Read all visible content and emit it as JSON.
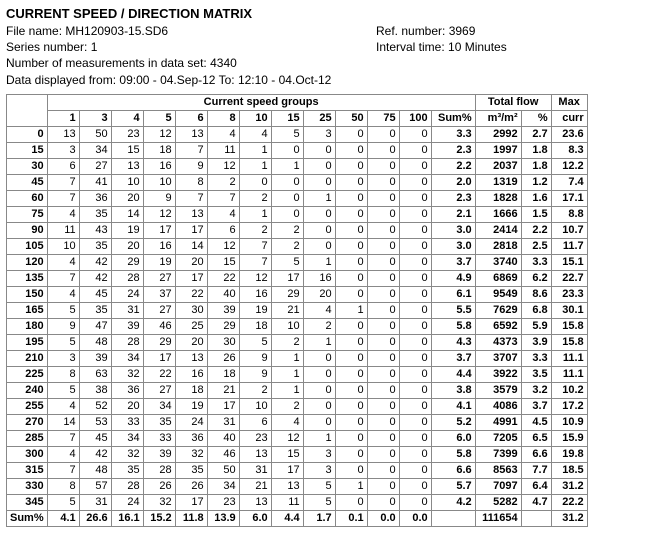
{
  "header": {
    "title": "CURRENT SPEED / DIRECTION MATRIX",
    "file_label": "File name: ",
    "file_value": "MH120903-15.SD6",
    "ref_label": "Ref. number: ",
    "ref_value": "3969",
    "series_label": "Series number: ",
    "series_value": "1",
    "interval_label": "Interval time: ",
    "interval_value": "10 Minutes",
    "count_label": "Number of measurements in data set: ",
    "count_value": "4340",
    "range_label": "Data displayed from: ",
    "range_from": "09:00 - 04.Sep-12",
    "range_to_label": "  To: ",
    "range_to": "12:10 - 04.Oct-12"
  },
  "columns": {
    "group_title": "Current speed groups",
    "total_flow_title": "Total flow",
    "max_title": "Max",
    "speed_headers": [
      "1",
      "3",
      "4",
      "5",
      "6",
      "8",
      "10",
      "15",
      "25",
      "50",
      "75",
      "100"
    ],
    "sum_pct": "Sum%",
    "flow_unit": "m³/m²",
    "pct": "%",
    "curr": "curr"
  },
  "rows": [
    {
      "dir": "0",
      "v": [
        "13",
        "50",
        "23",
        "12",
        "13",
        "4",
        "4",
        "5",
        "3",
        "0",
        "0",
        "0"
      ],
      "sum": "3.3",
      "flow": "2992",
      "pct": "2.7",
      "curr": "23.6"
    },
    {
      "dir": "15",
      "v": [
        "3",
        "34",
        "15",
        "18",
        "7",
        "11",
        "1",
        "0",
        "0",
        "0",
        "0",
        "0"
      ],
      "sum": "2.3",
      "flow": "1997",
      "pct": "1.8",
      "curr": "8.3"
    },
    {
      "dir": "30",
      "v": [
        "6",
        "27",
        "13",
        "16",
        "9",
        "12",
        "1",
        "1",
        "0",
        "0",
        "0",
        "0"
      ],
      "sum": "2.2",
      "flow": "2037",
      "pct": "1.8",
      "curr": "12.2"
    },
    {
      "dir": "45",
      "v": [
        "7",
        "41",
        "10",
        "10",
        "8",
        "2",
        "0",
        "0",
        "0",
        "0",
        "0",
        "0"
      ],
      "sum": "2.0",
      "flow": "1319",
      "pct": "1.2",
      "curr": "7.4"
    },
    {
      "dir": "60",
      "v": [
        "7",
        "36",
        "20",
        "9",
        "7",
        "7",
        "2",
        "0",
        "1",
        "0",
        "0",
        "0"
      ],
      "sum": "2.3",
      "flow": "1828",
      "pct": "1.6",
      "curr": "17.1"
    },
    {
      "dir": "75",
      "v": [
        "4",
        "35",
        "14",
        "12",
        "13",
        "4",
        "1",
        "0",
        "0",
        "0",
        "0",
        "0"
      ],
      "sum": "2.1",
      "flow": "1666",
      "pct": "1.5",
      "curr": "8.8"
    },
    {
      "dir": "90",
      "v": [
        "11",
        "43",
        "19",
        "17",
        "17",
        "6",
        "2",
        "2",
        "0",
        "0",
        "0",
        "0"
      ],
      "sum": "3.0",
      "flow": "2414",
      "pct": "2.2",
      "curr": "10.7"
    },
    {
      "dir": "105",
      "v": [
        "10",
        "35",
        "20",
        "16",
        "14",
        "12",
        "7",
        "2",
        "0",
        "0",
        "0",
        "0"
      ],
      "sum": "3.0",
      "flow": "2818",
      "pct": "2.5",
      "curr": "11.7"
    },
    {
      "dir": "120",
      "v": [
        "4",
        "42",
        "29",
        "19",
        "20",
        "15",
        "7",
        "5",
        "1",
        "0",
        "0",
        "0"
      ],
      "sum": "3.7",
      "flow": "3740",
      "pct": "3.3",
      "curr": "15.1"
    },
    {
      "dir": "135",
      "v": [
        "7",
        "42",
        "28",
        "27",
        "17",
        "22",
        "12",
        "17",
        "16",
        "0",
        "0",
        "0"
      ],
      "sum": "4.9",
      "flow": "6869",
      "pct": "6.2",
      "curr": "22.7"
    },
    {
      "dir": "150",
      "v": [
        "4",
        "45",
        "24",
        "37",
        "22",
        "40",
        "16",
        "29",
        "20",
        "0",
        "0",
        "0"
      ],
      "sum": "6.1",
      "flow": "9549",
      "pct": "8.6",
      "curr": "23.3"
    },
    {
      "dir": "165",
      "v": [
        "5",
        "35",
        "31",
        "27",
        "30",
        "39",
        "19",
        "21",
        "4",
        "1",
        "0",
        "0"
      ],
      "sum": "5.5",
      "flow": "7629",
      "pct": "6.8",
      "curr": "30.1"
    },
    {
      "dir": "180",
      "v": [
        "9",
        "47",
        "39",
        "46",
        "25",
        "29",
        "18",
        "10",
        "2",
        "0",
        "0",
        "0"
      ],
      "sum": "5.8",
      "flow": "6592",
      "pct": "5.9",
      "curr": "15.8"
    },
    {
      "dir": "195",
      "v": [
        "5",
        "48",
        "28",
        "29",
        "20",
        "30",
        "5",
        "2",
        "1",
        "0",
        "0",
        "0"
      ],
      "sum": "4.3",
      "flow": "4373",
      "pct": "3.9",
      "curr": "15.8"
    },
    {
      "dir": "210",
      "v": [
        "3",
        "39",
        "34",
        "17",
        "13",
        "26",
        "9",
        "1",
        "0",
        "0",
        "0",
        "0"
      ],
      "sum": "3.7",
      "flow": "3707",
      "pct": "3.3",
      "curr": "11.1"
    },
    {
      "dir": "225",
      "v": [
        "8",
        "63",
        "32",
        "22",
        "16",
        "18",
        "9",
        "1",
        "0",
        "0",
        "0",
        "0"
      ],
      "sum": "4.4",
      "flow": "3922",
      "pct": "3.5",
      "curr": "11.1"
    },
    {
      "dir": "240",
      "v": [
        "5",
        "38",
        "36",
        "27",
        "18",
        "21",
        "2",
        "1",
        "0",
        "0",
        "0",
        "0"
      ],
      "sum": "3.8",
      "flow": "3579",
      "pct": "3.2",
      "curr": "10.2"
    },
    {
      "dir": "255",
      "v": [
        "4",
        "52",
        "20",
        "34",
        "19",
        "17",
        "10",
        "2",
        "0",
        "0",
        "0",
        "0"
      ],
      "sum": "4.1",
      "flow": "4086",
      "pct": "3.7",
      "curr": "17.2"
    },
    {
      "dir": "270",
      "v": [
        "14",
        "53",
        "33",
        "35",
        "24",
        "31",
        "6",
        "4",
        "0",
        "0",
        "0",
        "0"
      ],
      "sum": "5.2",
      "flow": "4991",
      "pct": "4.5",
      "curr": "10.9"
    },
    {
      "dir": "285",
      "v": [
        "7",
        "45",
        "34",
        "33",
        "36",
        "40",
        "23",
        "12",
        "1",
        "0",
        "0",
        "0"
      ],
      "sum": "6.0",
      "flow": "7205",
      "pct": "6.5",
      "curr": "15.9"
    },
    {
      "dir": "300",
      "v": [
        "4",
        "42",
        "32",
        "39",
        "32",
        "46",
        "13",
        "15",
        "3",
        "0",
        "0",
        "0"
      ],
      "sum": "5.8",
      "flow": "7399",
      "pct": "6.6",
      "curr": "19.8"
    },
    {
      "dir": "315",
      "v": [
        "7",
        "48",
        "35",
        "28",
        "35",
        "50",
        "31",
        "17",
        "3",
        "0",
        "0",
        "0"
      ],
      "sum": "6.6",
      "flow": "8563",
      "pct": "7.7",
      "curr": "18.5"
    },
    {
      "dir": "330",
      "v": [
        "8",
        "57",
        "28",
        "26",
        "26",
        "34",
        "21",
        "13",
        "5",
        "1",
        "0",
        "0"
      ],
      "sum": "5.7",
      "flow": "7097",
      "pct": "6.4",
      "curr": "31.2"
    },
    {
      "dir": "345",
      "v": [
        "5",
        "31",
        "24",
        "32",
        "17",
        "23",
        "13",
        "11",
        "5",
        "0",
        "0",
        "0"
      ],
      "sum": "4.2",
      "flow": "5282",
      "pct": "4.7",
      "curr": "22.2"
    }
  ],
  "footer": {
    "label": "Sum%",
    "v": [
      "4.1",
      "26.6",
      "16.1",
      "15.2",
      "11.8",
      "13.9",
      "6.0",
      "4.4",
      "1.7",
      "0.1",
      "0.0",
      "0.0"
    ],
    "sum": "",
    "flow": "111654",
    "pct": "",
    "curr": "31.2"
  }
}
